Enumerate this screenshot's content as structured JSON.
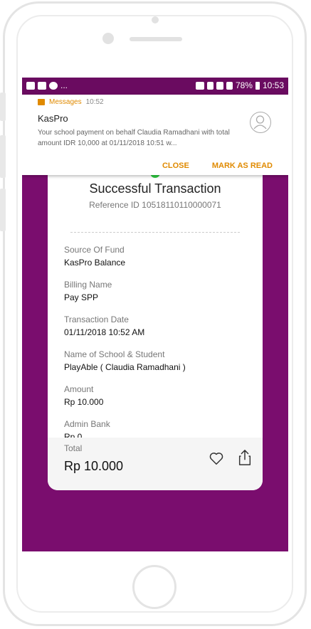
{
  "statusbar": {
    "battery": "78%",
    "time": "10:53"
  },
  "notification": {
    "app_name": "Messages",
    "time": "10:52",
    "title": "KasPro",
    "body": "Your school payment on behalf Claudia Ramadhani with total amount IDR 10,000 at 01/11/2018 10:51 w...",
    "close_label": "CLOSE",
    "mark_read_label": "MARK AS READ"
  },
  "receipt": {
    "title": "Successful Transaction",
    "reference": "Reference ID 10518110110000071",
    "fields": [
      {
        "label": "Source Of Fund",
        "value": "KasPro Balance"
      },
      {
        "label": "Billing Name",
        "value": "Pay SPP"
      },
      {
        "label": "Transaction Date",
        "value": "01/11/2018 10:52 AM"
      },
      {
        "label": "Name of School & Student",
        "value": "PlayAble ( Claudia Ramadhani )"
      },
      {
        "label": "Amount",
        "value": "Rp 10.000"
      },
      {
        "label": "Admin Bank",
        "value": "Rp 0"
      }
    ],
    "total_label": "Total",
    "total_value": "Rp 10.000"
  },
  "colors": {
    "brand": "#7a0d6e",
    "accent": "#e08a00",
    "success": "#2ecc40"
  },
  "icons": [
    "messages-icon",
    "avatar-icon",
    "heart-icon",
    "share-icon"
  ]
}
